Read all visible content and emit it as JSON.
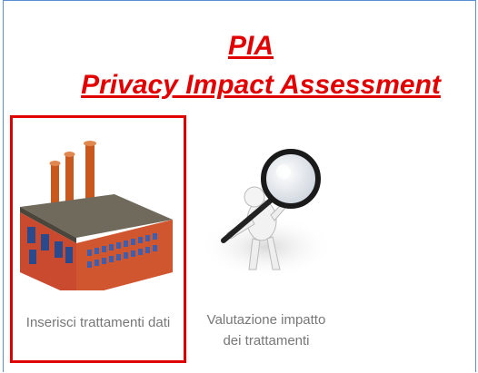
{
  "header": {
    "title_line1": "PIA",
    "title_line2": "Privacy Impact Assessment"
  },
  "tiles": [
    {
      "label": "Inserisci trattamenti dati",
      "icon": "factory-icon",
      "selected": true
    },
    {
      "label": "Valutazione impatto dei trattamenti",
      "icon": "magnifier-person-icon",
      "selected": false
    }
  ],
  "colors": {
    "title": "#e30000",
    "selection_border": "#e00000",
    "frame_border": "#5b8fd4",
    "label": "#777777"
  }
}
